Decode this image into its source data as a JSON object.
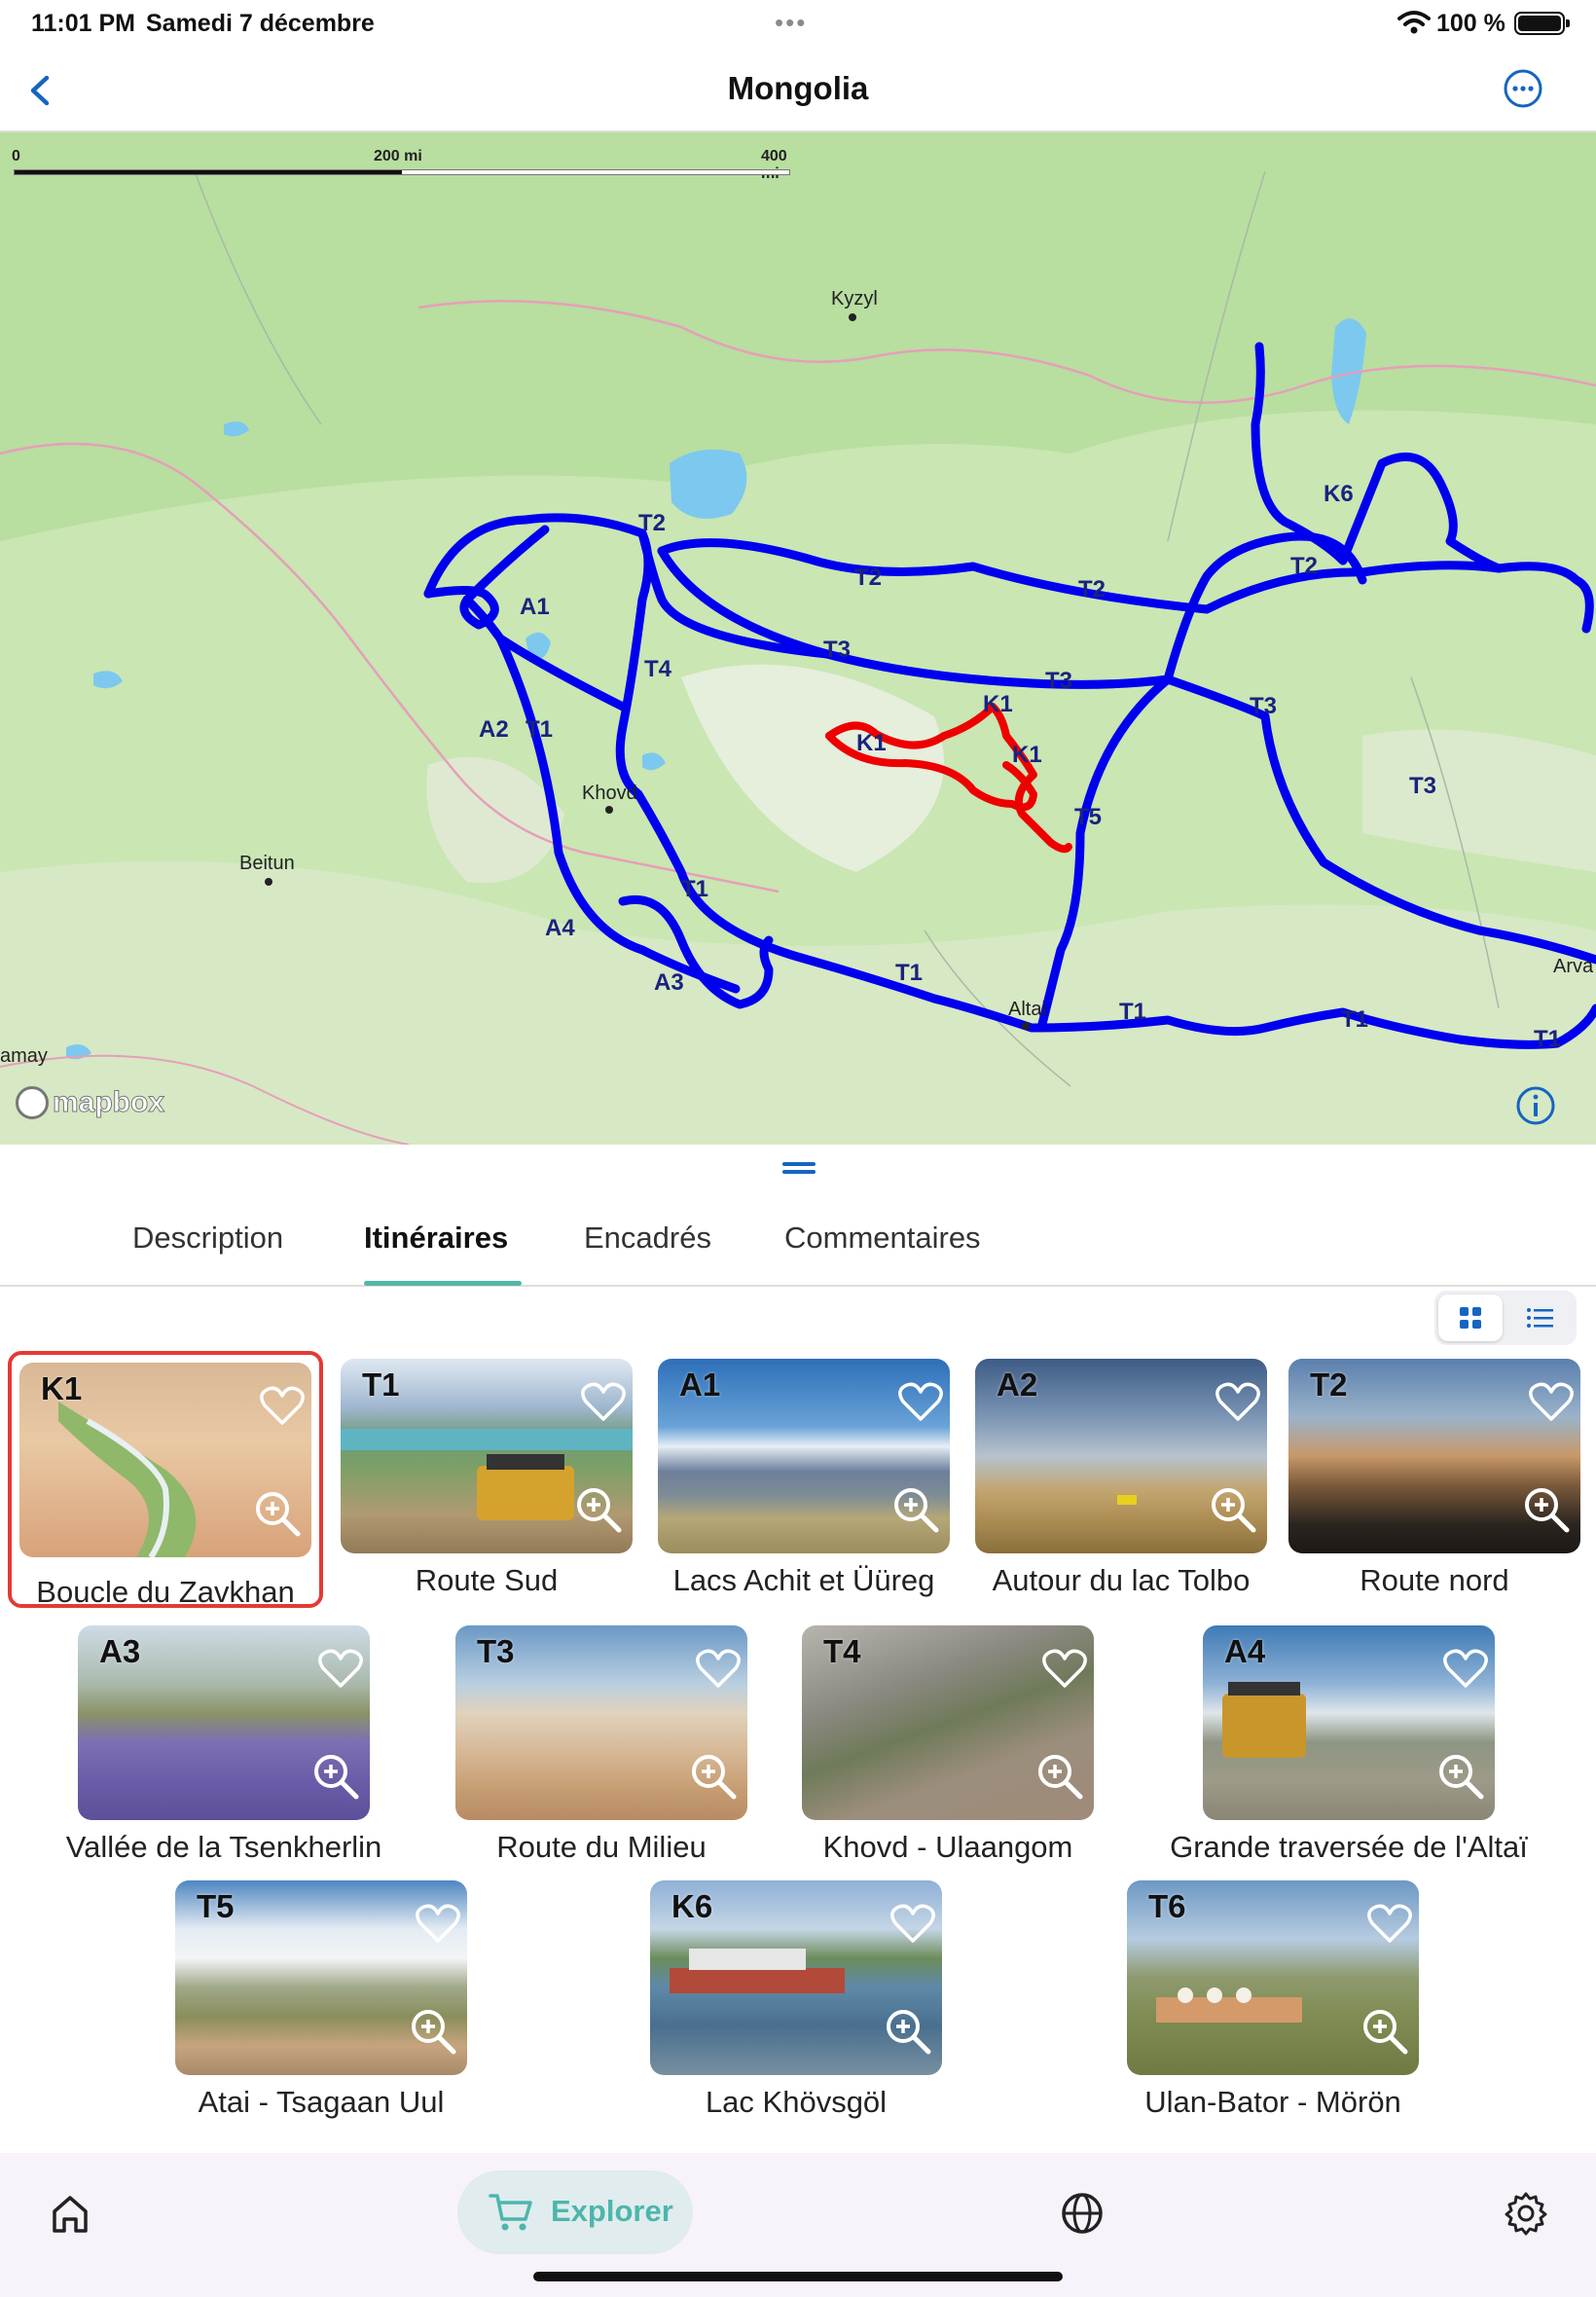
{
  "status_bar": {
    "time": "11:01 PM",
    "date": "Samedi 7 décembre",
    "multitask": "•••",
    "battery": "100 %"
  },
  "nav": {
    "title": "Mongolia"
  },
  "map": {
    "scale_labels": [
      "0",
      "200 mi",
      "400 mi"
    ],
    "cities": [
      "Kyzyl",
      "Khovd",
      "Beitun",
      "Altai",
      "Arva",
      "amay"
    ],
    "attribution": "mapbox",
    "route_labels": [
      "T2",
      "A1",
      "T4",
      "A2",
      "T1",
      "A4",
      "A3",
      "T1",
      "T1",
      "T2",
      "T2",
      "T3",
      "T3",
      "K1",
      "K1",
      "K1",
      "T5",
      "T3",
      "T3",
      "T1",
      "T1",
      "T1",
      "K6",
      "T2"
    ],
    "route_color": "#0000ee",
    "highlight_route_color": "#ee0000"
  },
  "tabs": [
    {
      "label": "Description"
    },
    {
      "label": "Itinéraires"
    },
    {
      "label": "Encadrés"
    },
    {
      "label": "Commentaires"
    }
  ],
  "active_tab": "Itinéraires",
  "accent_color": "#52b8a8",
  "routes": [
    {
      "code": "K1",
      "name": "Boucle du Zavkhan",
      "selected": true
    },
    {
      "code": "T1",
      "name": "Route Sud"
    },
    {
      "code": "A1",
      "name": "Lacs Achit et Üüreg"
    },
    {
      "code": "A2",
      "name": "Autour du lac Tolbo"
    },
    {
      "code": "T2",
      "name": "Route nord"
    },
    {
      "code": "A3",
      "name": "Vallée de la Tsenkherlin"
    },
    {
      "code": "T3",
      "name": "Route du Milieu"
    },
    {
      "code": "T4",
      "name": "Khovd - Ulaangom"
    },
    {
      "code": "A4",
      "name": "Grande traversée de l'Altaï"
    },
    {
      "code": "T5",
      "name": "Atai - Tsagaan Uul"
    },
    {
      "code": "K6",
      "name": "Lac Khövsgöl"
    },
    {
      "code": "T6",
      "name": "Ulan-Bator - Mörön"
    }
  ],
  "bottom_bar": {
    "explorer_label": "Explorer"
  }
}
